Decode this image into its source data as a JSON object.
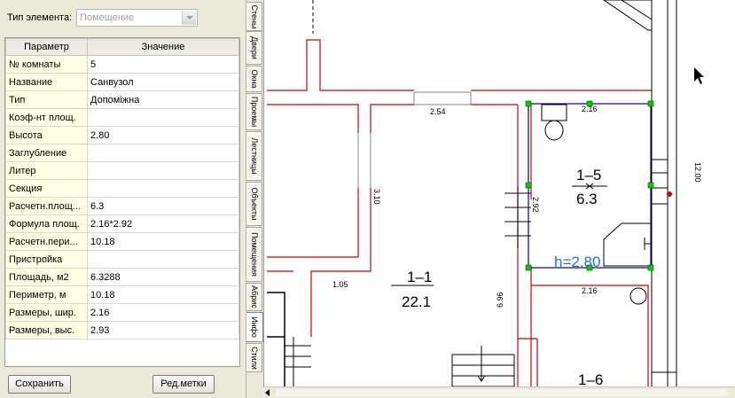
{
  "element_type": {
    "label": "Тип элемента:",
    "value": "Помещение"
  },
  "grid": {
    "headers": [
      "Параметр",
      "Значение"
    ],
    "rows": [
      [
        "№ комнаты",
        "5"
      ],
      [
        "Название",
        "Санвузол"
      ],
      [
        "Тип",
        "Допоміжна"
      ],
      [
        "Коэф-нт площ.",
        ""
      ],
      [
        "Высота",
        "2.80"
      ],
      [
        "Заглубление",
        ""
      ],
      [
        "Литер",
        ""
      ],
      [
        "Секция",
        ""
      ],
      [
        "Расчетн.площ...",
        "6.3"
      ],
      [
        "Формула площ.",
        "2.16*2.92"
      ],
      [
        "Расчетн.пери...",
        "10.18"
      ],
      [
        "Пристройка",
        ""
      ],
      [
        "Площадь, м2",
        "6.3288"
      ],
      [
        "Периметр, м",
        "10.18"
      ],
      [
        "Размеры, шир.",
        "2.16"
      ],
      [
        "Размеры, выс.",
        "2.93"
      ]
    ]
  },
  "buttons": {
    "save": "Сохранить",
    "edit_labels": "Ред.метки"
  },
  "tabs": [
    "Стены",
    "Двери",
    "Окна",
    "Проемы",
    "Лестницы",
    "Объекты",
    "Помещения",
    "Абрис",
    "Инфо",
    "Стили"
  ],
  "active_tab": "Инфо",
  "drawing": {
    "dims": [
      "2.54",
      "2.16",
      "2.92",
      "3.10",
      "1.05",
      "6.96",
      "2.16",
      "12.00"
    ],
    "rooms": [
      {
        "id": "1–5",
        "area": "6.3"
      },
      {
        "id": "1–1",
        "area": "22.1"
      },
      {
        "id": "1–6",
        "area": ""
      }
    ],
    "height_label": "h=2.80"
  },
  "colors": {
    "wall_red": "#d20000",
    "selection_blue": "#000090",
    "handle_green": "#00d000",
    "label_blue": "#2a6fd6"
  }
}
